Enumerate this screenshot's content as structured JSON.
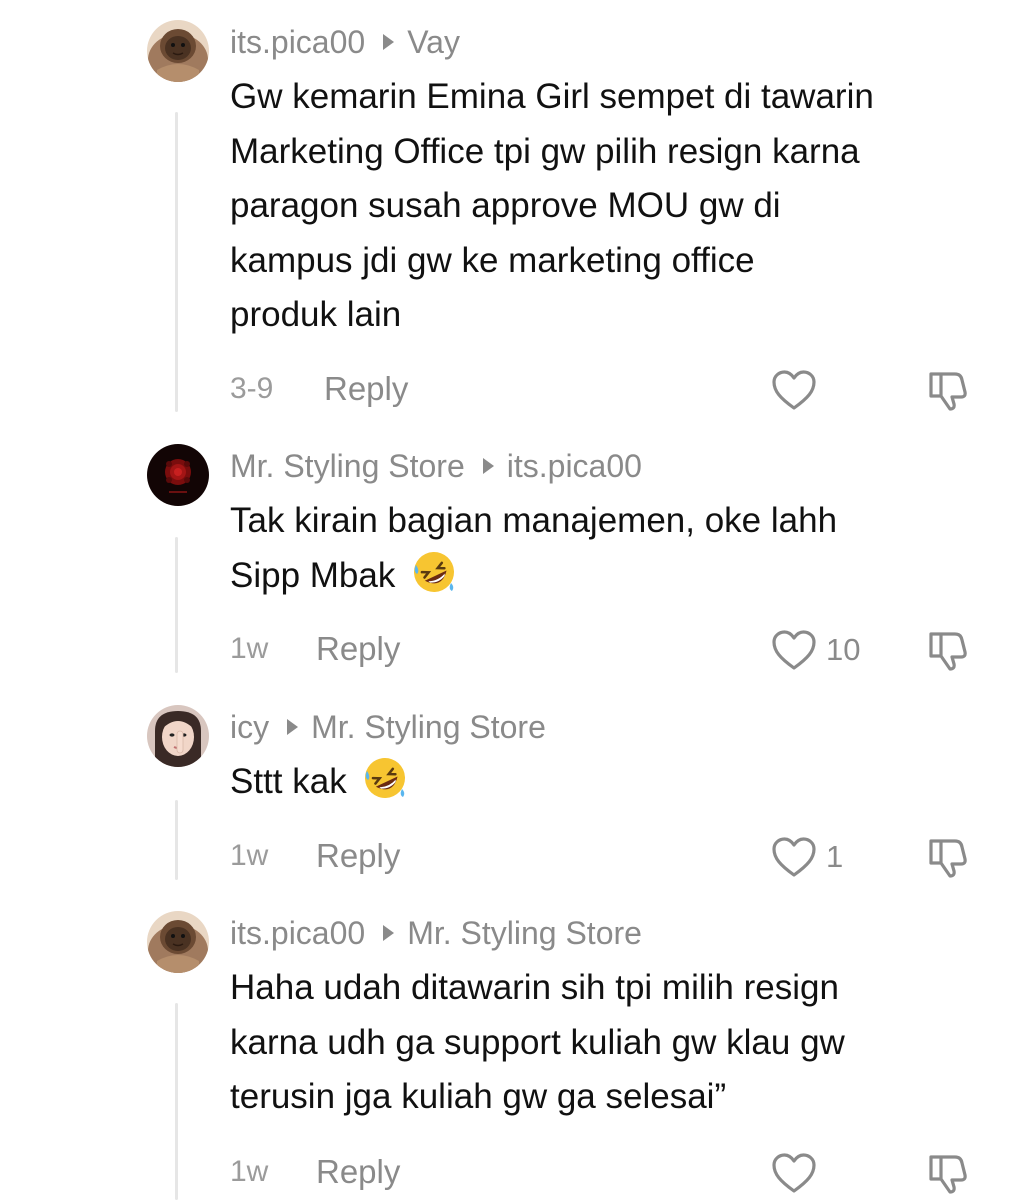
{
  "comments": [
    {
      "author": "its.pica00",
      "reply_to": "Vay",
      "avatar": "brown-hooded-face-avatar",
      "lines": [
        "Gw kemarin Emina Girl sempet di tawarin",
        "Marketing Office tpi gw pilih resign karna",
        "paragon susah approve MOU gw di",
        "kampus jdi gw ke marketing office",
        "produk lain"
      ],
      "time": "3-9",
      "reply_label": "Reply",
      "likes": ""
    },
    {
      "author": "Mr. Styling Store",
      "reply_to": "its.pica00",
      "avatar": "dark-red-rose-avatar",
      "lines": [
        "Tak kirain bagian manajemen, oke lahh",
        "Sipp Mbak"
      ],
      "emoji": "rolling-on-floor-laughing-emoji",
      "time": "1w",
      "reply_label": "Reply",
      "likes": "10"
    },
    {
      "author": "icy",
      "reply_to": "Mr. Styling Store",
      "avatar": "girl-selfie-avatar",
      "lines": [
        "Sttt kak"
      ],
      "emoji": "rolling-on-floor-laughing-emoji",
      "time": "1w",
      "reply_label": "Reply",
      "likes": "1"
    },
    {
      "author": "its.pica00",
      "reply_to": "Mr. Styling Store",
      "avatar": "brown-hooded-face-avatar",
      "lines": [
        "Haha udah ditawarin sih tpi milih resign",
        "karna udh ga support kuliah gw klau gw",
        "terusin jga kuliah gw ga selesai”"
      ],
      "time": "1w",
      "reply_label": "Reply",
      "likes": ""
    }
  ],
  "icons": {
    "like": "heart-outline-icon",
    "dislike": "thumbs-down-outline-icon",
    "separator": "triangle-right-icon"
  },
  "colors": {
    "primary_text": "#111111",
    "secondary_text": "#8a8a8a",
    "thread_line": "#e6e6e6",
    "background": "#ffffff"
  }
}
